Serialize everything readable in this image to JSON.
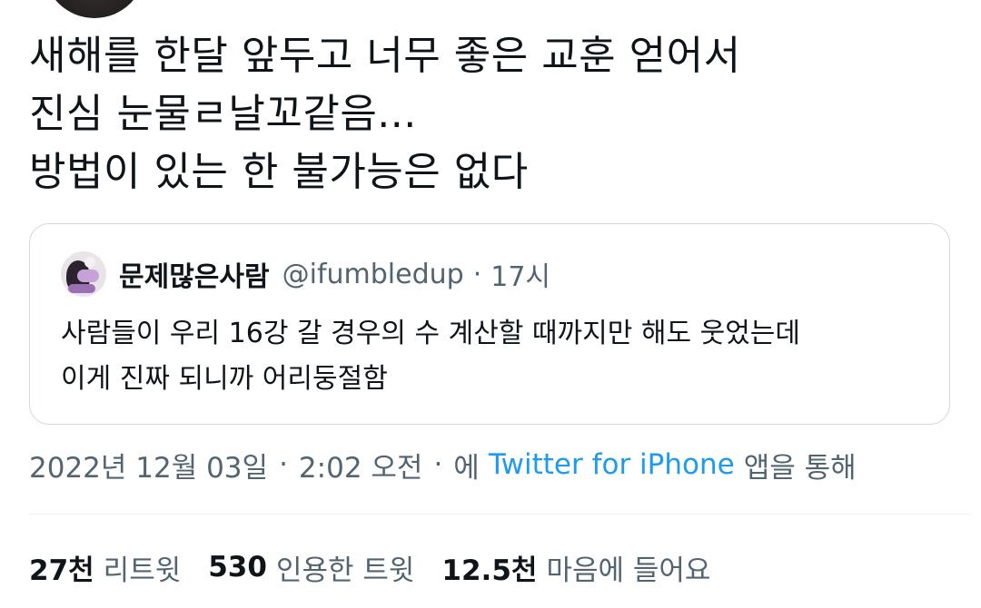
{
  "tweet": {
    "lines": [
      "새해를 한달 앞두고 너무 좋은 교훈 얻어서",
      "진심 눈물ㄹ날꼬같음...",
      "방법이 있는 한 불가능은 없다"
    ]
  },
  "quote": {
    "name": "문제많은사람",
    "handle": "@ifumbledup",
    "separator": "·",
    "time": "17시",
    "lines": [
      "사람들이 우리 16강 갈 경우의 수 계산할 때까지만 해도 웃었는데",
      "이게 진짜 되니까 어리둥절함"
    ]
  },
  "meta": {
    "date": "2022년 12월 03일",
    "separator": "·",
    "time": "2:02 오전",
    "via_prefix": "에",
    "source": "Twitter for iPhone",
    "via_suffix": "앱을 통해"
  },
  "stats": [
    {
      "count": "27천",
      "label": "리트윗"
    },
    {
      "count": "530",
      "label": "인용한 트윗"
    },
    {
      "count": "12.5천",
      "label": "마음에 들어요"
    }
  ],
  "colors": {
    "text": "#0f1419",
    "secondary": "#536471",
    "link": "#1d9bf0",
    "border": "#cfd9de"
  }
}
